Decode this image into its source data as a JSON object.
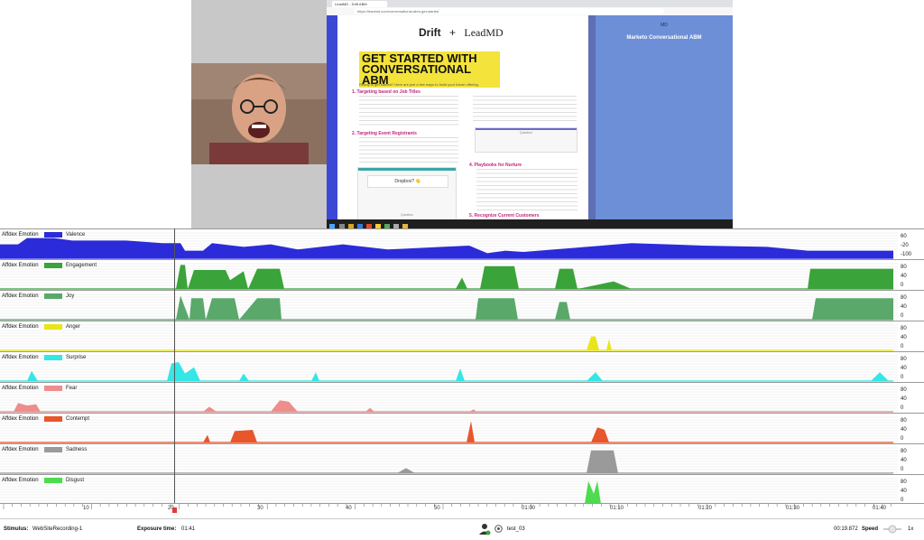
{
  "browser": {
    "tab_title": "LeadMD - Drift ABM",
    "url": "https://leadmd.com/conversational-abm-get-started"
  },
  "document": {
    "logo_left": "Drift",
    "logo_plus": "+",
    "logo_right": "LeadMD",
    "headline": "GET STARTED WITH CONVERSATIONAL ABM",
    "intro": "Ready to get started? Here are just a few ways to build your future offering.",
    "items": [
      {
        "title": "1. Targeting based on Job Titles"
      },
      {
        "title": "2. Targeting Event Registrants"
      },
      {
        "title": "4. Playbooks for Nurture"
      },
      {
        "title": "5. Recognize Current Customers"
      }
    ],
    "card_text": "Dropbox? 👋",
    "question_label": "Question"
  },
  "side_panel": {
    "logo": "MD",
    "title": "Marketo Conversational ABM"
  },
  "rows": [
    {
      "label": "Affdex Emotion",
      "name": "Valence",
      "color": "#2b2bd9",
      "ticks": [
        "60",
        "-20",
        "-100"
      ]
    },
    {
      "label": "Affdex Emotion",
      "name": "Engagement",
      "color": "#3aa33a",
      "ticks": [
        "80",
        "40",
        "0"
      ]
    },
    {
      "label": "Affdex Emotion",
      "name": "Joy",
      "color": "#5aa86a",
      "ticks": [
        "80",
        "40",
        "0"
      ]
    },
    {
      "label": "Affdex Emotion",
      "name": "Anger",
      "color": "#e8e51a",
      "ticks": [
        "80",
        "40",
        "0"
      ]
    },
    {
      "label": "Affdex Emotion",
      "name": "Surprise",
      "color": "#34e6e6",
      "ticks": [
        "80",
        "40",
        "0"
      ]
    },
    {
      "label": "Affdex Emotion",
      "name": "Fear",
      "color": "#ee8d8d",
      "ticks": [
        "80",
        "40",
        "0"
      ]
    },
    {
      "label": "Affdex Emotion",
      "name": "Contempt",
      "color": "#e8562c",
      "ticks": [
        "80",
        "40",
        "0"
      ]
    },
    {
      "label": "Affdex Emotion",
      "name": "Sadness",
      "color": "#9a9a9a",
      "ticks": [
        "80",
        "40",
        "0"
      ]
    },
    {
      "label": "Affdex Emotion",
      "name": "Disgust",
      "color": "#4ddc4d",
      "ticks": [
        "80",
        "40",
        "0"
      ]
    }
  ],
  "timeline": {
    "labels": [
      "10",
      "20",
      "30",
      "40",
      "50",
      "01:00",
      "01:10",
      "01:20",
      "01:30",
      "01:40"
    ]
  },
  "status": {
    "stimulus_label": "Stimulus:",
    "stimulus_value": "WebSiteRecording-1",
    "exposure_label": "Exposure time:",
    "exposure_value": "01:41",
    "respondent": "test_03",
    "current_time": "00:19.872",
    "speed_label": "Speed",
    "speed_value": "1x"
  },
  "icons": {
    "user": "user-icon",
    "respondent": "respondent-icon",
    "speed_slider": "speed-slider"
  }
}
